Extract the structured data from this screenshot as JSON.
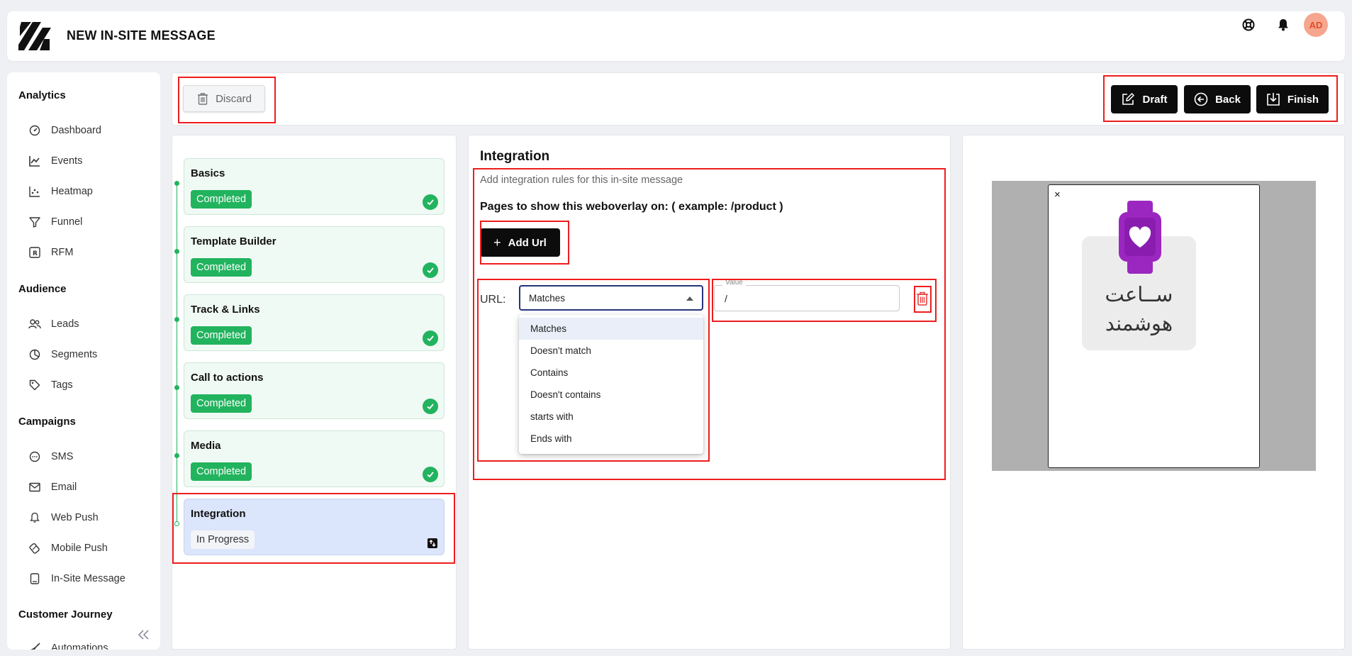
{
  "header": {
    "title": "NEW IN-SITE MESSAGE",
    "avatar": "AD"
  },
  "sidebar": {
    "sections": [
      {
        "title": "Analytics",
        "items": [
          {
            "label": "Dashboard",
            "icon": "dashboard-icon"
          },
          {
            "label": "Events",
            "icon": "chart-line-icon"
          },
          {
            "label": "Heatmap",
            "icon": "scatter-icon"
          },
          {
            "label": "Funnel",
            "icon": "funnel-icon"
          },
          {
            "label": "RFM",
            "icon": "rfm-icon"
          }
        ]
      },
      {
        "title": "Audience",
        "items": [
          {
            "label": "Leads",
            "icon": "users-icon"
          },
          {
            "label": "Segments",
            "icon": "pie-icon"
          },
          {
            "label": "Tags",
            "icon": "tag-icon"
          }
        ]
      },
      {
        "title": "Campaigns",
        "items": [
          {
            "label": "SMS",
            "icon": "chat-icon"
          },
          {
            "label": "Email",
            "icon": "mail-icon"
          },
          {
            "label": "Web Push",
            "icon": "bell-icon"
          },
          {
            "label": "Mobile Push",
            "icon": "mobile-push-icon"
          },
          {
            "label": "In-Site Message",
            "icon": "tablet-icon"
          }
        ]
      },
      {
        "title": "Customer Journey",
        "items": [
          {
            "label": "Automations",
            "icon": "rocket-icon"
          }
        ]
      }
    ]
  },
  "actions": {
    "discard": "Discard",
    "draft": "Draft",
    "back": "Back",
    "finish": "Finish"
  },
  "steps": [
    {
      "title": "Basics",
      "status": "Completed"
    },
    {
      "title": "Template Builder",
      "status": "Completed"
    },
    {
      "title": "Track & Links",
      "status": "Completed"
    },
    {
      "title": "Call to actions",
      "status": "Completed"
    },
    {
      "title": "Media",
      "status": "Completed"
    },
    {
      "title": "Integration",
      "status": "In Progress"
    }
  ],
  "integration": {
    "title": "Integration",
    "subtitle": "Add integration rules for this in-site message",
    "pages_label": "Pages to show this weboverlay on: ( example: /product )",
    "add_url": "Add Url",
    "url_label": "URL:",
    "select_value": "Matches",
    "options": [
      "Matches",
      "Doesn't match",
      "Contains",
      "Doesn't contains",
      "starts with",
      "Ends with"
    ],
    "value_legend": "Value",
    "value": "/"
  },
  "preview": {
    "close": "×",
    "line1": "ســاعت",
    "line2": "هوشمند",
    "watch_color": "#9b27c0"
  },
  "colors": {
    "success": "#22b35e",
    "highlight": "#ee1d1d",
    "dark_button": "#0c0c0c"
  }
}
